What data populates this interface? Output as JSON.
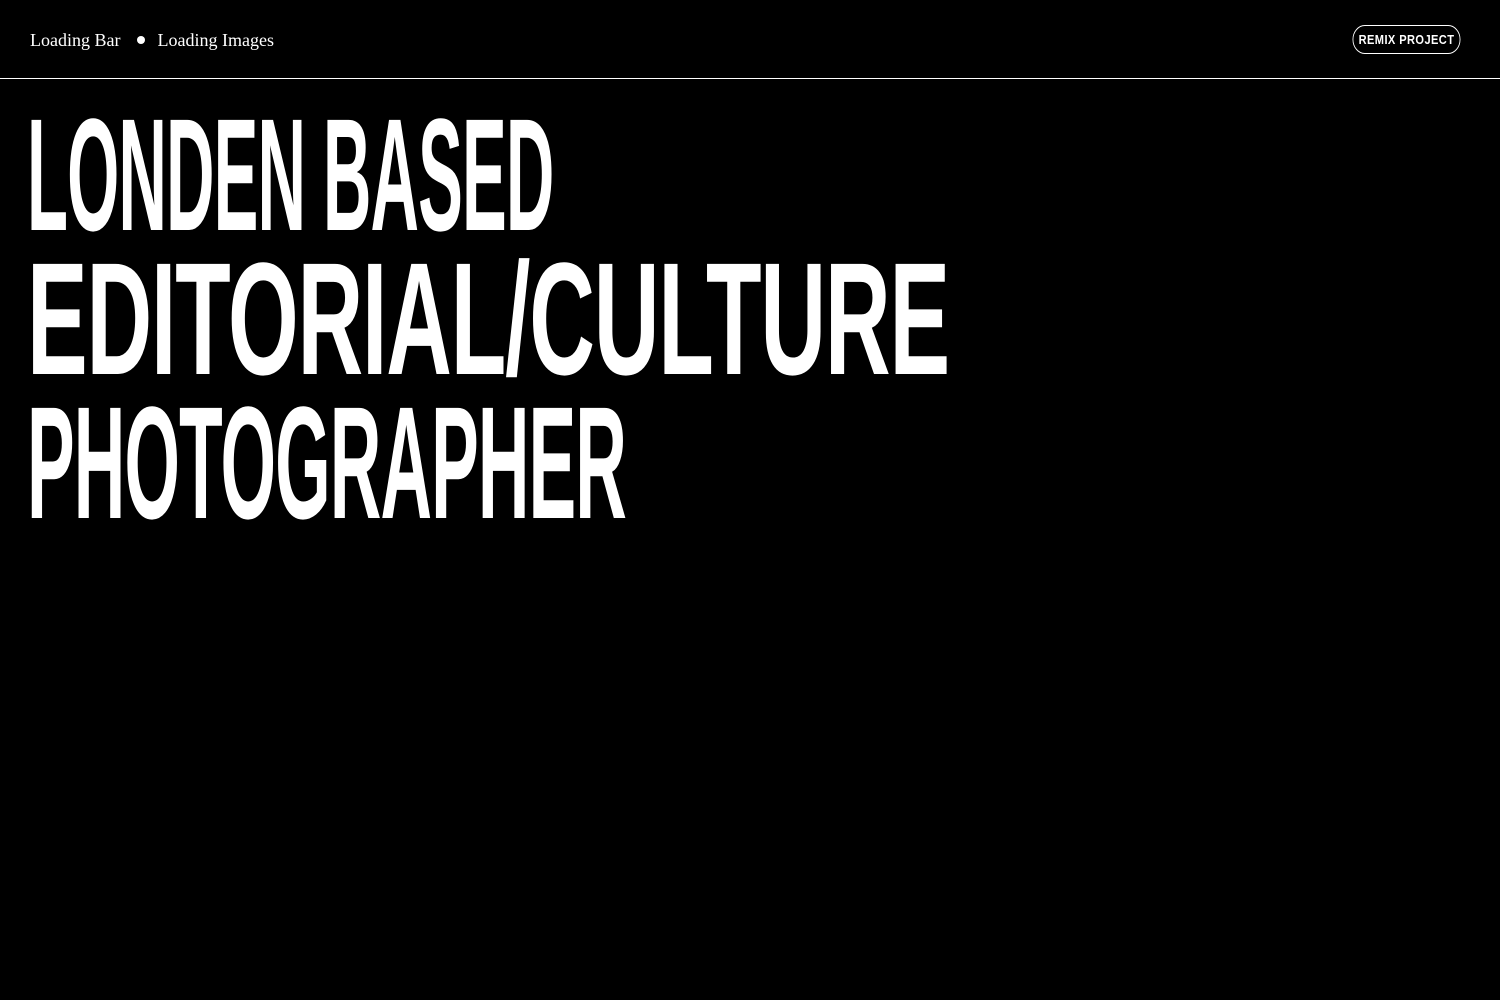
{
  "colors": {
    "background": "#000000",
    "foreground": "#ffffff"
  },
  "nav": {
    "items": [
      {
        "label": "Loading Bar"
      },
      {
        "label": "Loading Images"
      }
    ],
    "separator_icon": "bullet-dot-icon"
  },
  "header": {
    "remix_label": "REMIX PROJECT"
  },
  "hero": {
    "lines": [
      "LONDEN BASED",
      "EDITORIAL/CULTURE",
      "PHOTOGRAPHER"
    ]
  }
}
